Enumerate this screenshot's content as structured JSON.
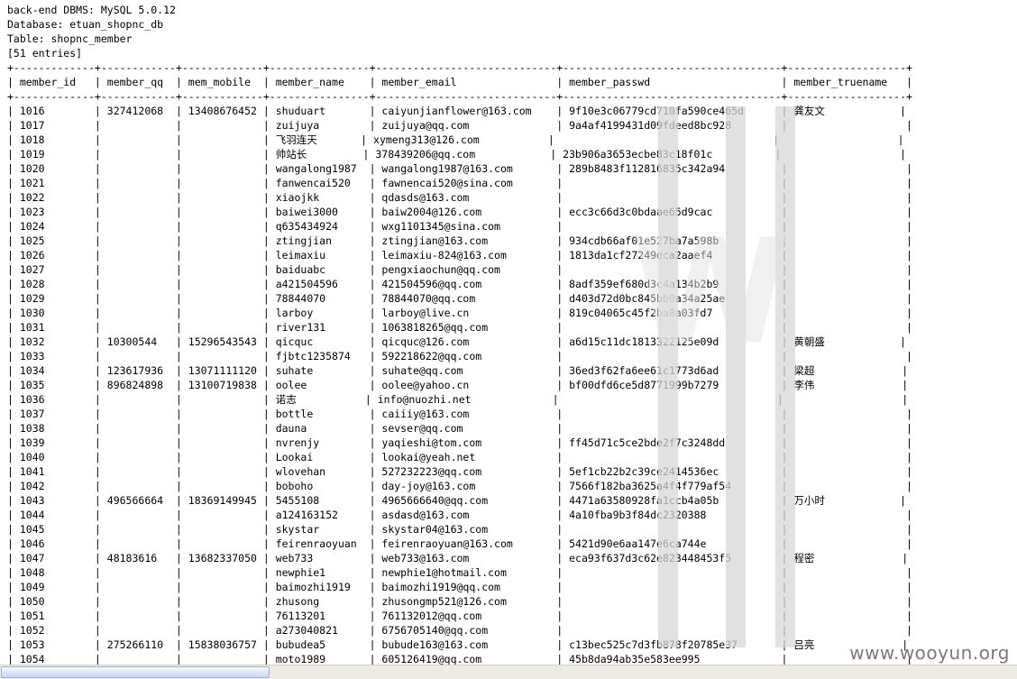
{
  "header_lines": [
    "back-end DBMS: MySQL 5.0.12",
    "Database: etuan_shopnc_db",
    "Table: shopnc_member",
    "[51 entries]"
  ],
  "columns": [
    "member_id",
    "member_qq",
    "mem_mobile",
    "member_name",
    "member_email",
    "member_passwd",
    "member_truename"
  ],
  "rows": [
    [
      "1016",
      "327412068",
      "13408676452",
      "shuduart",
      "caiyunjianflower@163.com",
      "9f10e3c06779cd710fa590ce465d",
      "龚友文"
    ],
    [
      "1017",
      "",
      "",
      "zuijuya",
      "zuijuya@qq.com",
      "9a4af4199431d09fdeed8bc928",
      ""
    ],
    [
      "1018",
      "",
      "",
      "飞羽连天",
      "xymeng313@126.com",
      "",
      ""
    ],
    [
      "1019",
      "",
      "",
      "帅站长",
      "378439206@qq.com",
      "23b906a3653ecbe83c18f01c",
      ""
    ],
    [
      "1020",
      "",
      "",
      "wangalong1987",
      "wangalong1987@163.com",
      "289b8483f112816835c342a94",
      ""
    ],
    [
      "1021",
      "",
      "",
      "fanwencai520",
      "fawnencai520@sina.com",
      "",
      ""
    ],
    [
      "1022",
      "",
      "",
      "xiaojkk",
      "qdasds@163.com",
      "",
      ""
    ],
    [
      "1023",
      "",
      "",
      "baiwei3000",
      "baiw2004@126.com",
      "ecc3c66d3c0bdaae65d9cac",
      ""
    ],
    [
      "1024",
      "",
      "",
      "q635434924",
      "wxg1101345@sina.com",
      "",
      ""
    ],
    [
      "1025",
      "",
      "",
      "ztingjian",
      "ztingjian@163.com",
      "934cdb66af01e527ba7a598b",
      ""
    ],
    [
      "1026",
      "",
      "",
      "leimaxiu",
      "leimaxiu-824@163.com",
      "1813da1cf27249dca2aaef4",
      ""
    ],
    [
      "1027",
      "",
      "",
      "baiduabc",
      "pengxiaochun@qq.com",
      "",
      ""
    ],
    [
      "1028",
      "",
      "",
      "a421504596",
      "421504596@qq.com",
      "8adf359ef680d3c4a134b2b9",
      ""
    ],
    [
      "1029",
      "",
      "",
      "78844070",
      "78844070@qq.com",
      "d403d72d0bc845bb0a34a25ae",
      ""
    ],
    [
      "1030",
      "",
      "",
      "larboy",
      "larboy@live.cn",
      "819c04065c45f2ba8a03fd7",
      ""
    ],
    [
      "1031",
      "",
      "",
      "river131",
      "1063818265@qq.com",
      "",
      ""
    ],
    [
      "1032",
      "10300544",
      "15296543543",
      "qicquc",
      "qicquc@126.com",
      "a6d15c11dc1813322125e09d",
      "黄朝盛"
    ],
    [
      "1033",
      "",
      "",
      "fjbtc1235874",
      "592218622@qq.com",
      "",
      ""
    ],
    [
      "1034",
      "123617936",
      "13071111120",
      "suhate",
      "suhate@qq.com",
      "36ed3f62fa6ee61c1773d6ad",
      "梁超"
    ],
    [
      "1035",
      "896824898",
      "13100719838",
      "oolee",
      "oolee@yahoo.cn",
      "bf00dfd6ce5d8771999b7279",
      "李伟"
    ],
    [
      "1036",
      "",
      "",
      "诺志",
      "info@nuozhi.net",
      "",
      ""
    ],
    [
      "1037",
      "",
      "",
      "bottle",
      "caiiiy@163.com",
      "",
      ""
    ],
    [
      "1038",
      "",
      "",
      "dauna",
      "sevser@qq.com",
      "",
      ""
    ],
    [
      "1039",
      "",
      "",
      "nvrenjy",
      "yaqieshi@tom.com",
      "ff45d71c5ce2bde2f7c3248dd",
      ""
    ],
    [
      "1040",
      "",
      "",
      "Lookai",
      "lookai@yeah.net",
      "",
      ""
    ],
    [
      "1041",
      "",
      "",
      "wlovehan",
      "527232223@qq.com",
      "5ef1cb22b2c39ce2414536ec",
      ""
    ],
    [
      "1042",
      "",
      "",
      "boboho",
      "day-joy@163.com",
      "7566f182ba3625a4f4f779af54",
      ""
    ],
    [
      "1043",
      "496566664",
      "18369149945",
      "5455108",
      "4965666640@qq.com",
      "4471a63580928fa1ccb4a05b",
      "万小时"
    ],
    [
      "1044",
      "",
      "",
      "a124163152",
      "asdasd@163.com",
      "4a10fba9b3f84dc2320388",
      ""
    ],
    [
      "1045",
      "",
      "",
      "skystar",
      "skystar04@163.com",
      "",
      ""
    ],
    [
      "1046",
      "",
      "",
      "feirenraoyuan",
      "feirenraoyuan@163.com",
      "5421d90e6aa147e6ca744e",
      ""
    ],
    [
      "1047",
      "48183616",
      "13682337050",
      "web733",
      "web733@163.com",
      "eca93f637d3c62e823448453f5",
      "程密"
    ],
    [
      "1048",
      "",
      "",
      "newphie1",
      "newphie1@hotmail.com",
      "",
      ""
    ],
    [
      "1049",
      "",
      "",
      "baimozhi1919",
      "baimozhi1919@qq.com",
      "",
      ""
    ],
    [
      "1050",
      "",
      "",
      "zhusong",
      "zhusongmp521@126.com",
      "",
      ""
    ],
    [
      "1051",
      "",
      "",
      "76113201",
      "761132012@qq.com",
      "",
      ""
    ],
    [
      "1052",
      "",
      "",
      "a273040821",
      "6756705140@qq.com",
      "",
      ""
    ],
    [
      "1053",
      "275266110",
      "15838036757",
      "bubudea5",
      "bubude163@163.com",
      "c13bec525c7d3fb878f20785e37",
      "吕亮"
    ],
    [
      "1054",
      "",
      "",
      "moto1989",
      "605126419@qq.com",
      "45b8da94ab35e583ee995",
      ""
    ]
  ],
  "watermark_text": "www.wooyun.org"
}
